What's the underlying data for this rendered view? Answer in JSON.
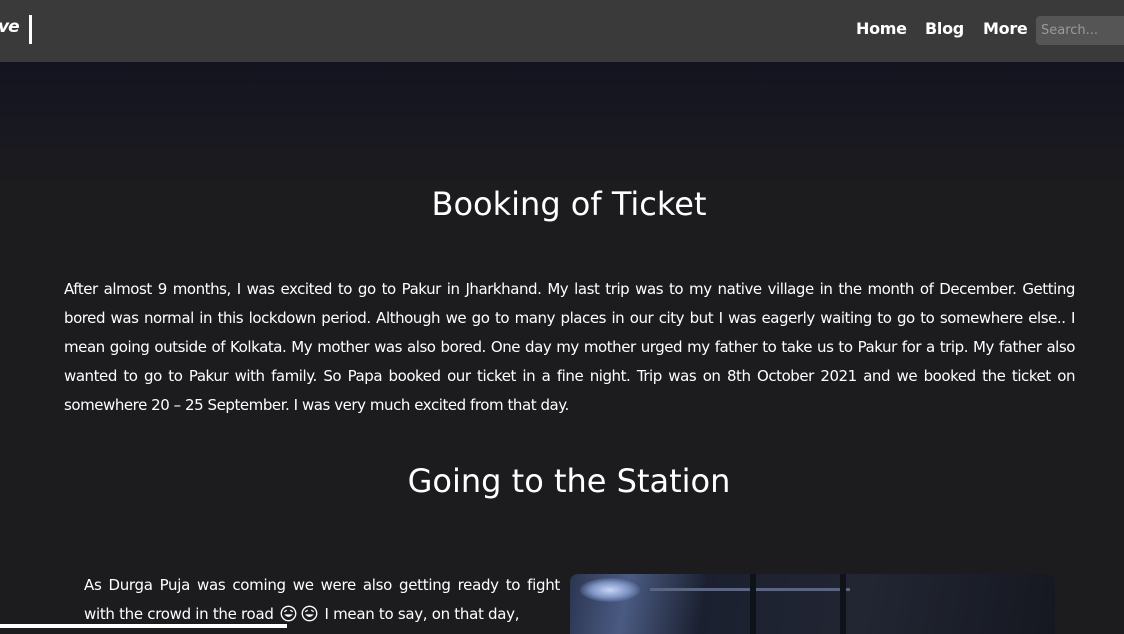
{
  "navbar": {
    "brand": "ve",
    "links": [
      "Home",
      "Blog",
      "More"
    ],
    "search_placeholder": "Search..."
  },
  "article": {
    "heading_1": "Booking of Ticket",
    "paragraph_1": "After almost 9 months, I was excited to go to Pakur in Jharkhand. My last trip was to my native village in the month of December. Getting bored was normal in this lockdown period. Although we go to many places in our city but I was eagerly waiting to go to somewhere else.. I mean going outside of Kolkata. My mother was also bored. One day my mother urged my father to take us to Pakur for a trip. My father also wanted to go to Pakur with family. So Papa booked our ticket in a fine night. Trip was on 8th October 2021 and we booked the ticket on somewhere 20 – 25 September. I was very much excited from that day.",
    "heading_2": "Going to the Station",
    "paragraph_2_before": "As Durga Puja was coming we were also getting ready to fight with the crowd in the road",
    "paragraph_2_after": " I mean to say, on that day,",
    "emoji_icon": "rolling-on-floor-laughing-emoji"
  }
}
